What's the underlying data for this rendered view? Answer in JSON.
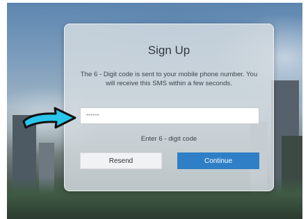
{
  "signup": {
    "title": "Sign Up",
    "message": "The 6 - Digit code is sent to your mobile phone number. You will receive this SMS within a few seconds.",
    "code_input": {
      "placeholder": "******",
      "value": ""
    },
    "hint": "Enter 6 - digit code",
    "resend_label": "Resend",
    "continue_label": "Continue"
  },
  "colors": {
    "continue_button": "#2f7fc6",
    "resend_button": "#f1f2f3",
    "card_background": "#d4dbe0",
    "arrow_fill": "#29c5ea",
    "arrow_outline": "#111111"
  },
  "annotation": {
    "icon": "pointing-arrow-icon"
  }
}
